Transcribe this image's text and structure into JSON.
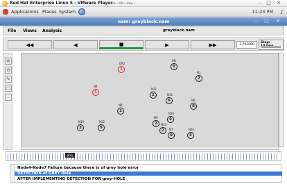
{
  "vm": {
    "title": "Red Hat Enterprise Linux 5 - VMware Player",
    "menus": "File • VM • Help •",
    "window_controls": "– □ ×"
  },
  "panel": {
    "applications": "Applications",
    "places": "Places",
    "system": "System",
    "clock": "11:23 PM"
  },
  "nam": {
    "title": "nam: greyblack.nam",
    "window_controls": "– □ ×",
    "menu": {
      "file": "File",
      "views": "Views",
      "analysis": "Analysis"
    },
    "file": "greyblack.nam",
    "toolbar": {
      "rewind": "◀◀",
      "back": "◀",
      "stop": "■",
      "play": "▶",
      "ff": "▶▶"
    },
    "time": "3.702000",
    "step": "Step: 10.0ms"
  },
  "nodes": [
    {
      "num": "1",
      "label": "DR2",
      "red": true
    },
    {
      "num": "0",
      "label": "SN"
    },
    {
      "num": "2",
      "label": "N1"
    },
    {
      "num": "1",
      "label": "N4",
      "red": true
    },
    {
      "num": "8",
      "label": "N6"
    },
    {
      "num": "2",
      "label": "N11"
    },
    {
      "num": "6",
      "label": "N15"
    },
    {
      "num": "2",
      "label": "N8"
    },
    {
      "num": "2",
      "label": "N9"
    },
    {
      "num": "3",
      "label": "N14"
    },
    {
      "num": "9",
      "label": "N12"
    },
    {
      "num": "0",
      "label": "N10"
    },
    {
      "num": "2",
      "label": "N13"
    },
    {
      "num": "0",
      "label": "N7"
    },
    {
      "num": "5",
      "label": "N16"
    }
  ],
  "timeline": {
    "marker": "grey"
  },
  "log": [
    "Node4-Node7 Failure because there is of grey hole error",
    "DETECTION of GREY Hole",
    "AFTER IMPLEMENTING DETECTION FOR grey-HOLE"
  ],
  "colors": {
    "node_red": "#e02020",
    "selection": "#3c79d6",
    "title_bar": "#4d7ab8",
    "play_indicator": "#1f9a3a"
  }
}
